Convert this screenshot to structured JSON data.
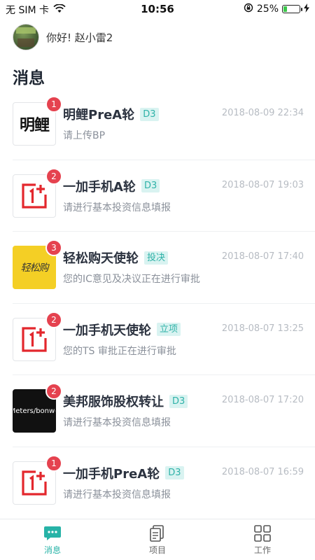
{
  "status_bar": {
    "carrier": "无 SIM 卡",
    "time": "10:56",
    "battery": "25%",
    "battery_level": 0.25
  },
  "greeting": {
    "text": "你好! 赵小雷2"
  },
  "page_title": "消息",
  "messages": [
    {
      "logo_text": "明鲤",
      "badge": "1",
      "title": "明鲤PreA轮",
      "tag": "D3",
      "time": "2018-08-09 22:34",
      "subtitle": "请上传BP"
    },
    {
      "logo_text": "",
      "badge": "2",
      "title": "一加手机A轮",
      "tag": "D3",
      "time": "2018-08-07 19:03",
      "subtitle": "请进行基本投资信息填报"
    },
    {
      "logo_text": "轻松购",
      "badge": "3",
      "title": "轻松购天使轮",
      "tag": "投决",
      "time": "2018-08-07 17:40",
      "subtitle": "您的IC意见及决议正在进行审批"
    },
    {
      "logo_text": "",
      "badge": "2",
      "title": "一加手机天使轮",
      "tag": "立项",
      "time": "2018-08-07 13:25",
      "subtitle": "您的TS 审批正在进行审批"
    },
    {
      "logo_text": "Meters/bonwe",
      "badge": "2",
      "title": "美邦服饰股权转让",
      "tag": "D3",
      "time": "2018-08-07 17:20",
      "subtitle": "请进行基本投资信息填报"
    },
    {
      "logo_text": "",
      "badge": "1",
      "title": "一加手机PreA轮",
      "tag": "D3",
      "time": "2018-08-07 16:59",
      "subtitle": "请进行基本投资信息填报"
    }
  ],
  "tabs": [
    {
      "label": "消息",
      "icon": "chat-icon",
      "active": true
    },
    {
      "label": "项目",
      "icon": "document-icon",
      "active": false
    },
    {
      "label": "工作",
      "icon": "grid-icon",
      "active": false
    }
  ],
  "colors": {
    "accent": "#27b3a7",
    "badge": "#e5424f",
    "tag_bg": "#d9f3f1",
    "tag_text": "#2fb2a8",
    "oneplus_red": "#e3272d"
  }
}
